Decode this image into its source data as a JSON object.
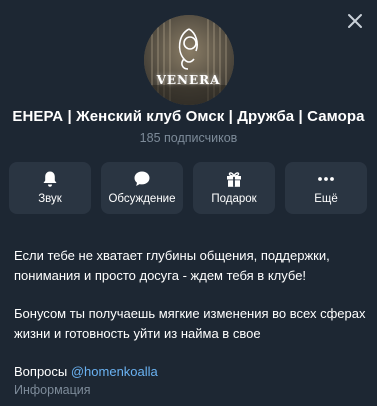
{
  "header": {
    "avatar_text": "VENERA",
    "title": "ЕНЕРА | Женский клуб Омск | Дружба | Самора",
    "subscribers": "185 подписчиков"
  },
  "actions": [
    {
      "label": "Звук",
      "icon": "bell-icon"
    },
    {
      "label": "Обсуждение",
      "icon": "chat-icon"
    },
    {
      "label": "Подарок",
      "icon": "gift-icon"
    },
    {
      "label": "Ещё",
      "icon": "more-icon"
    }
  ],
  "description": {
    "paragraph1": "Если тебе не хватает глубины общения, поддержки, понимания и просто досуга - ждем тебя в клубе!",
    "paragraph2": "Бонусом ты получаешь мягкие изменения во всех сферах жизни и готовность уйти из найма в свое",
    "contacts_prefix": "Вопросы ",
    "contacts_link": "@homenkoalla"
  },
  "info_label": "Информация",
  "colors": {
    "background": "#1d2733",
    "button_bg": "#2a3542",
    "link": "#6ab2f2",
    "muted": "#7d8b99"
  }
}
